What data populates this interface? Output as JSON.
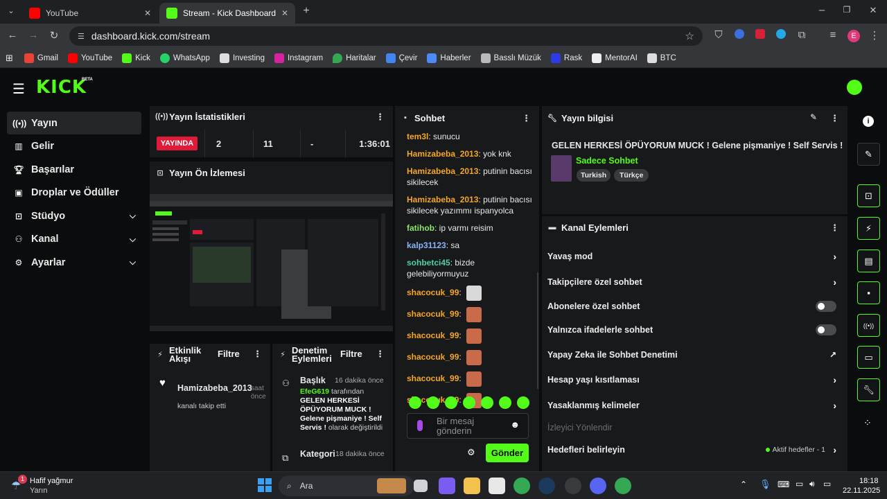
{
  "browser": {
    "tabs": [
      {
        "label": "YouTube",
        "active": false
      },
      {
        "label": "Stream - Kick Dashboard",
        "active": true
      }
    ],
    "new_tab_icon": "plus-icon",
    "url": "dashboard.kick.com/stream",
    "profile_initial": "E",
    "bookmarks": [
      "Gmail",
      "YouTube",
      "Kick",
      "WhatsApp",
      "Investing",
      "Instagram",
      "Haritalar",
      "Çevir",
      "Haberler",
      "Basslı Müzük",
      "Rask",
      "MentorAI",
      "BTC"
    ]
  },
  "app": {
    "logo": "KICK",
    "logo_badge": "BETA"
  },
  "sidebar": {
    "items": [
      {
        "label": "Yayın",
        "icon": "broadcast-icon",
        "active": true,
        "expandable": false
      },
      {
        "label": "Gelir",
        "icon": "chart-icon",
        "active": false,
        "expandable": false
      },
      {
        "label": "Başarılar",
        "icon": "trophy-icon",
        "active": false,
        "expandable": false
      },
      {
        "label": "Droplar ve Ödüller",
        "icon": "gift-icon",
        "active": false,
        "expandable": false
      },
      {
        "label": "Stüdyo",
        "icon": "studio-icon",
        "active": false,
        "expandable": true
      },
      {
        "label": "Kanal",
        "icon": "users-icon",
        "active": false,
        "expandable": true
      },
      {
        "label": "Ayarlar",
        "icon": "gear-icon",
        "active": false,
        "expandable": true
      }
    ]
  },
  "stats": {
    "title": "Yayın İstatistikleri",
    "live_label": "YAYINDA",
    "viewers": "2",
    "followers": "11",
    "subs": "-",
    "duration": "1:36:01"
  },
  "preview": {
    "title": "Yayın Ön İzlemesi"
  },
  "activity": {
    "title": "Etkinlik Akışı",
    "filter_label": "Filtre",
    "event_user": "Hamizabeba_2013",
    "event_time": "saat önce",
    "event_text": "kanalı takip etti"
  },
  "moderation": {
    "title": "Denetim Eylemleri",
    "filter_label": "Filtre",
    "entries": [
      {
        "label": "Başlık",
        "time": "16 dakika önce",
        "user": "EfeG619",
        "by_text": " tarafından",
        "value": "GELEN HERKESİ ÖPÜYORUM MUCK ! Gelene pişmaniye ! Self Servis !",
        "suffix": " olarak değiştirildi"
      },
      {
        "label": "Kategori",
        "time": "18 dakika önce"
      }
    ]
  },
  "chat": {
    "title": "Sohbet",
    "messages": [
      {
        "user": "tem3l",
        "text": "sunucu",
        "color": "#f5a623"
      },
      {
        "user": "Hamizabeba_2013",
        "text": "yok knk",
        "color": "#f5a623"
      },
      {
        "user": "Hamizabeba_2013",
        "text": "putinin bacısı sikilecek",
        "color": "#f5a623"
      },
      {
        "user": "Hamizabeba_2013",
        "text": "putinin bacısı sikilecek yazımmı ispanyolca",
        "color": "#f5a623"
      },
      {
        "user": "fatihob",
        "text": "ip varmı reisim",
        "color": "#8fe36b"
      },
      {
        "user": "kalp31123",
        "text": "sa",
        "color": "#8ab4f8"
      },
      {
        "user": "sohbetci45",
        "text": "bizde gelebiliyormuyuz",
        "color": "#4fd1a5"
      },
      {
        "user": "shacocuk_99",
        "text": "",
        "color": "#f5a623"
      },
      {
        "user": "shacocuk_99",
        "text": "",
        "color": "#f5a623"
      },
      {
        "user": "shacocuk_99",
        "text": "",
        "color": "#f5a623"
      },
      {
        "user": "shacocuk_99",
        "text": "",
        "color": "#f5a623"
      },
      {
        "user": "shacocuk_99",
        "text": "",
        "color": "#f5a623"
      },
      {
        "user": "shacocuk_99",
        "text": "",
        "color": "#f5a623"
      }
    ],
    "input_placeholder": "Bir mesaj gönderin",
    "send_label": "Gönder"
  },
  "stream_info": {
    "title": "Yayın bilgisi",
    "stream_title": "GELEN HERKESİ ÖPÜYORUM MUCK ! Gelene pişmaniye ! Self Servis !",
    "category": "Sadece Sohbet",
    "tags": [
      "Turkish",
      "Türkçe"
    ]
  },
  "channel_actions": {
    "title": "Kanal Eylemleri",
    "items": [
      {
        "label": "Yavaş mod",
        "control": "arrow"
      },
      {
        "label": "Takipçilere özel sohbet",
        "control": "arrow"
      },
      {
        "label": "Abonelere özel sohbet",
        "control": "toggle"
      },
      {
        "label": "Yalnızca ifadelerle sohbet",
        "control": "toggle"
      },
      {
        "label": "Yapay Zeka ile Sohbet Denetimi",
        "control": "external"
      },
      {
        "label": "Hesap yaşı kısıtlaması",
        "control": "arrow"
      },
      {
        "label": "Yasaklanmış kelimeler",
        "control": "arrow"
      }
    ],
    "raid_label": "İzleyici Yönlendir",
    "goals_label": "Hedefleri belirleyin",
    "goals_status": "Aktif hedefler - 1"
  },
  "taskbar": {
    "weather_title": "Hafif yağmur",
    "weather_sub": "Yarın",
    "weather_badge": "1",
    "search_label": "Ara",
    "time": "18:18",
    "date": "22.11.2025"
  },
  "colors": {
    "accent": "#53fc18",
    "live": "#e01b3a"
  }
}
